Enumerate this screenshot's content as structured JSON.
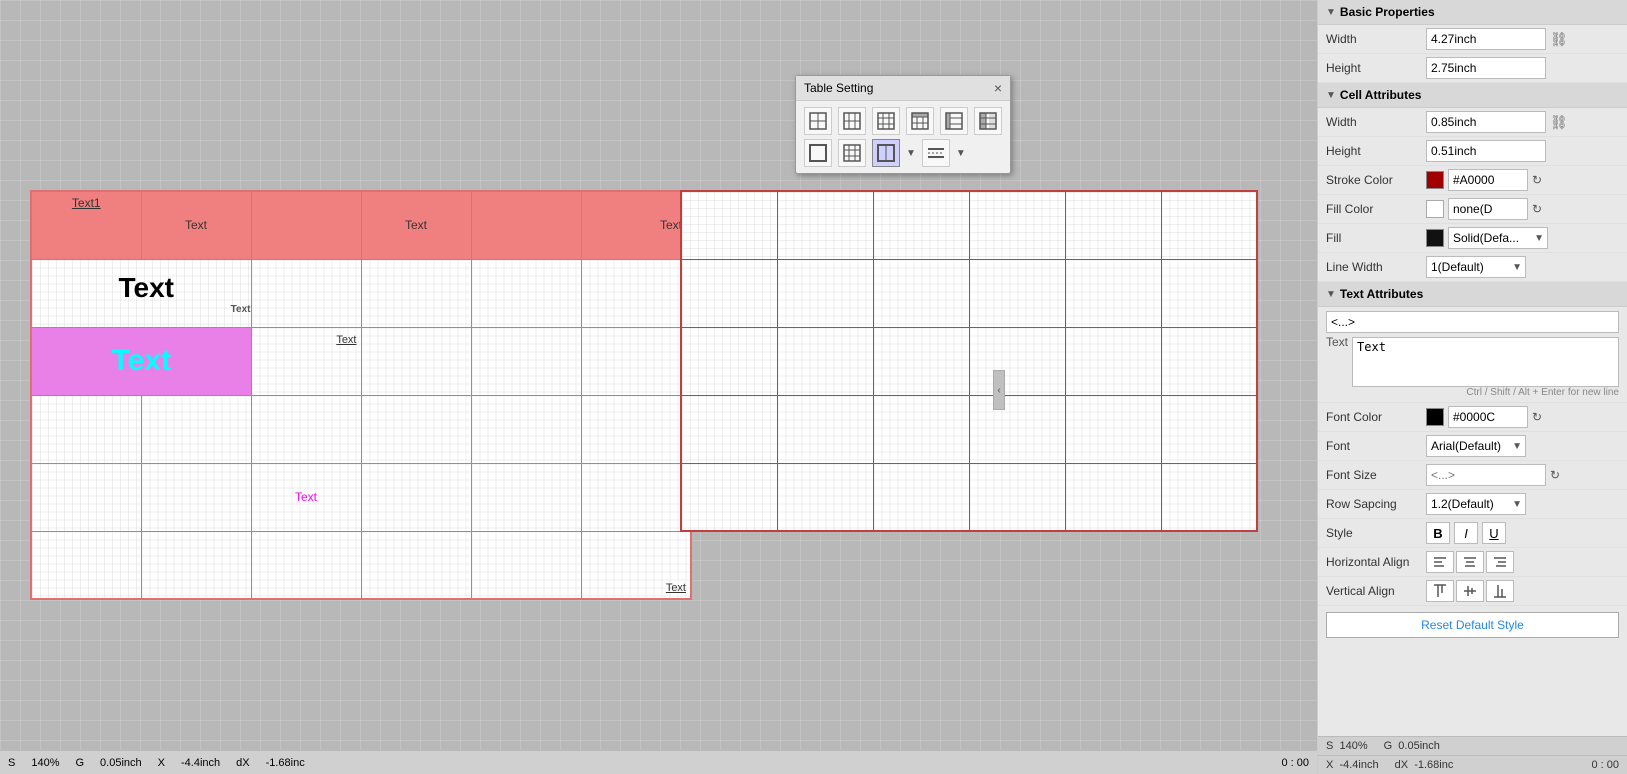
{
  "dialog": {
    "title": "Table Setting",
    "close_label": "×"
  },
  "left_table": {
    "rows": [
      [
        "Text1",
        "Text",
        "",
        "Text",
        "",
        "Text"
      ],
      [
        "Text",
        "",
        "Text",
        "",
        "",
        ""
      ],
      [
        "Text",
        "",
        "",
        "",
        "",
        ""
      ],
      [
        "",
        "",
        "",
        "",
        "",
        ""
      ],
      [
        "",
        "",
        "Text",
        "",
        "",
        ""
      ],
      [
        "",
        "",
        "",
        "",
        "",
        "Text"
      ]
    ]
  },
  "right_panel": {
    "basic_properties": {
      "title": "Basic Properties",
      "width_label": "Width",
      "width_value": "4.27inch",
      "height_label": "Height",
      "height_value": "2.75inch"
    },
    "cell_attributes": {
      "title": "Cell Attributes",
      "width_label": "Width",
      "width_value": "0.85inch",
      "height_label": "Height",
      "height_value": "0.51inch",
      "stroke_label": "Stroke Color",
      "stroke_color": "#A00000",
      "stroke_hex": "#A0000",
      "fill_color_label": "Fill Color",
      "fill_color_value": "none(D",
      "fill_label": "Fill",
      "fill_value": "Solid(Defa...",
      "line_width_label": "Line Width",
      "line_width_value": "1(Default)"
    },
    "text_attributes": {
      "title": "Text Attributes",
      "text_placeholder": "<...>",
      "text_label": "Text",
      "text_value": "Text",
      "hint": "Ctrl / Shift / Alt + Enter for new line",
      "font_color_label": "Font Color",
      "font_color": "#000000",
      "font_hex": "#0000C",
      "font_label": "Font",
      "font_value": "Arial(Default)",
      "font_size_label": "Font Size",
      "font_size_placeholder": "<...>",
      "row_spacing_label": "Row Sapcing",
      "row_spacing_value": "1.2(Default)",
      "style_label": "Style",
      "bold": "B",
      "italic": "I",
      "underline": "U",
      "h_align_label": "Horizontal Align",
      "v_align_label": "Vertical Align",
      "reset_label": "Reset Default Style"
    }
  },
  "status_bar": {
    "s_label": "S",
    "s_value": "140%",
    "g_label": "G",
    "g_value": "0.05inch",
    "x_label": "X",
    "x_value": "-4.4inch",
    "dx_label": "dX",
    "dx_value": "-1.68inc",
    "time": "0 : 00"
  },
  "icons": {
    "collapse": "▼",
    "lock": "⛓",
    "refresh": "↻",
    "close": "×"
  }
}
